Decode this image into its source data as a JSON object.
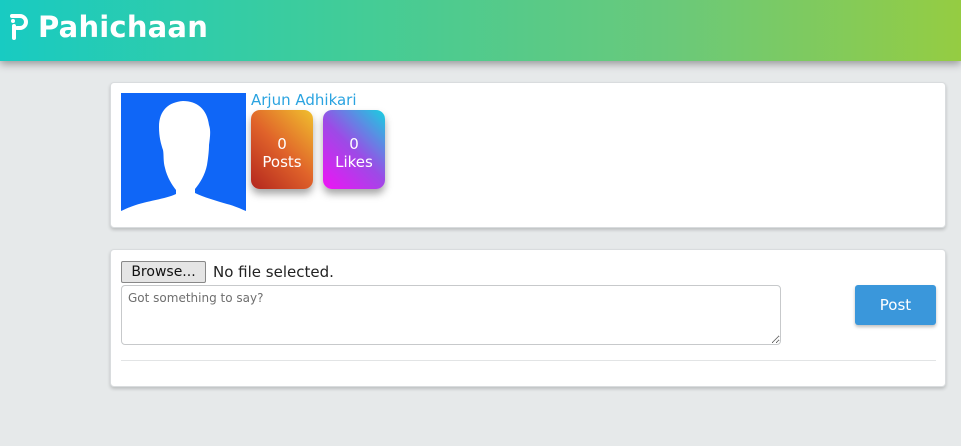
{
  "header": {
    "brand_name": "Pahichaan",
    "brand_icon": "p-logo-icon",
    "gradient_colors": [
      "#18cbc2",
      "#95cc42"
    ]
  },
  "profile": {
    "name": "Arjun Adhikari",
    "avatar_icon": "person-silhouette-icon",
    "avatar_background": "#0f66f7",
    "stats": {
      "posts_count": "0",
      "posts_label": "Posts",
      "likes_count": "0",
      "likes_label": "Likes"
    }
  },
  "post_form": {
    "browse_label": "Browse...",
    "file_status": "No file selected.",
    "text_placeholder": "Got something to say?",
    "text_value": "",
    "post_button_label": "Post",
    "accent_color": "#3a97db"
  }
}
